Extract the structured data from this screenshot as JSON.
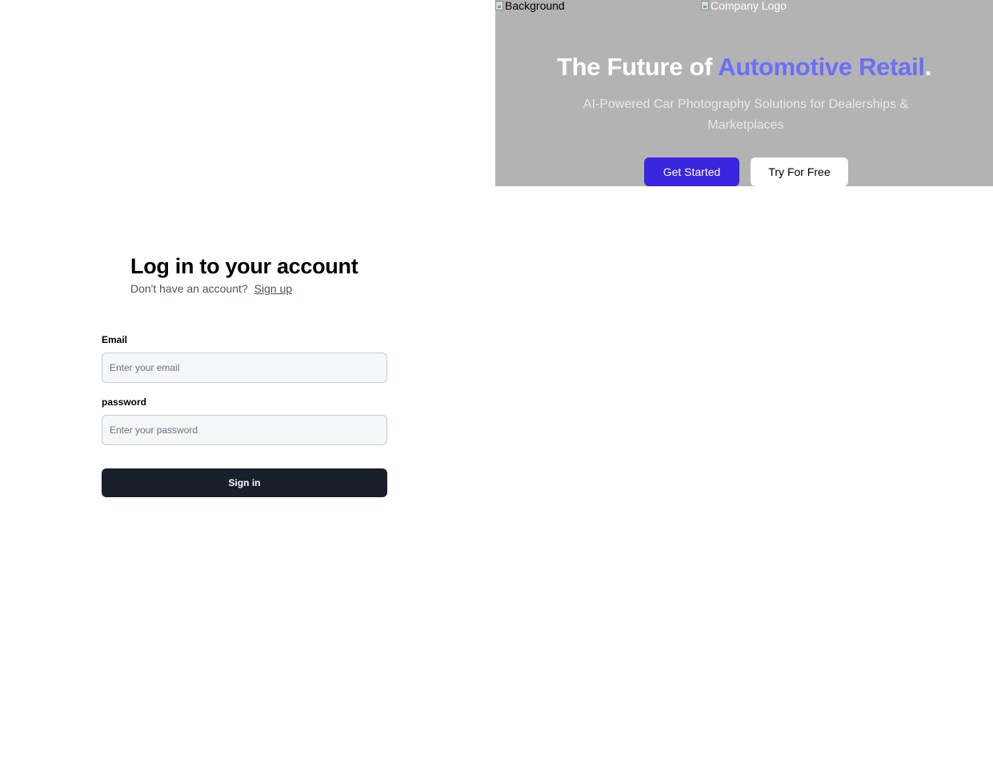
{
  "hero": {
    "background_alt": "Background",
    "logo_alt": "Company Logo",
    "title_prefix": "The Future of ",
    "title_accent": "Automotive Retail",
    "title_suffix": ".",
    "subtitle": "AI-Powered Car Photography Solutions for Dealerships & Marketplaces",
    "primary_button": "Get Started",
    "secondary_button": "Try For Free",
    "accent_color": "#6b6ef8",
    "primary_color": "#3a25e0"
  },
  "login": {
    "title": "Log in to your account",
    "no_account_text": "Don't have an account?",
    "signup_link": "Sign up",
    "email_label": "Email",
    "email_placeholder": "Enter your email",
    "email_value": "",
    "password_label": "password",
    "password_placeholder": "Enter your password",
    "password_value": "",
    "submit_label": "Sign in"
  }
}
